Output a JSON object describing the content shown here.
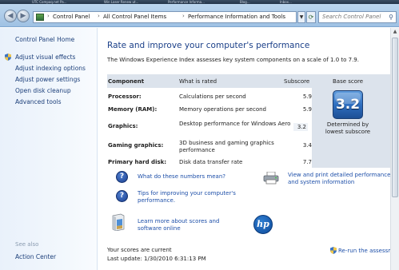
{
  "taskbar": {
    "items": [
      "UTC Compaq.net Pa...",
      "Win Laser Renew ut...",
      "Performance Informa...",
      "Blog...",
      "Inbox..."
    ]
  },
  "address": {
    "crumbs": [
      "Control Panel",
      "All Control Panel Items",
      "Performance Information and Tools"
    ],
    "search_placeholder": "Search Control Panel"
  },
  "sidebar": {
    "home": "Control Panel Home",
    "links": [
      "Adjust visual effects",
      "Adjust indexing options",
      "Adjust power settings",
      "Open disk cleanup",
      "Advanced tools"
    ],
    "see_also_label": "See also",
    "see_also": [
      "Action Center"
    ]
  },
  "main": {
    "title": "Rate and improve your computer's performance",
    "intro": "The Windows Experience Index assesses key system components on a scale of 1.0 to 7.9.",
    "table": {
      "headers": {
        "component": "Component",
        "what": "What is rated",
        "subscore": "Subscore",
        "base": "Base score"
      },
      "rows": [
        {
          "component": "Processor:",
          "what": "Calculations per second",
          "subscore": "5.9"
        },
        {
          "component": "Memory (RAM):",
          "what": "Memory operations per second",
          "subscore": "5.9"
        },
        {
          "component": "Graphics:",
          "what": "Desktop performance for Windows Aero",
          "subscore": "3.2"
        },
        {
          "component": "Gaming graphics:",
          "what": "3D business and gaming graphics performance",
          "subscore": "3.4"
        },
        {
          "component": "Primary hard disk:",
          "what": "Disk data transfer rate",
          "subscore": "7.7"
        }
      ],
      "base_score": "3.2",
      "base_caption": "Determined by lowest subscore"
    },
    "links": {
      "numbers": "What do these numbers mean?",
      "tips": "Tips for improving your computer's performance.",
      "print": "View and print detailed performance and system information",
      "learn": "Learn more about scores and software online"
    },
    "status": {
      "current": "Your scores are current",
      "last_update": "Last update: 1/30/2010 6:31:13 PM",
      "rerun": "Re-run the assessment"
    }
  }
}
